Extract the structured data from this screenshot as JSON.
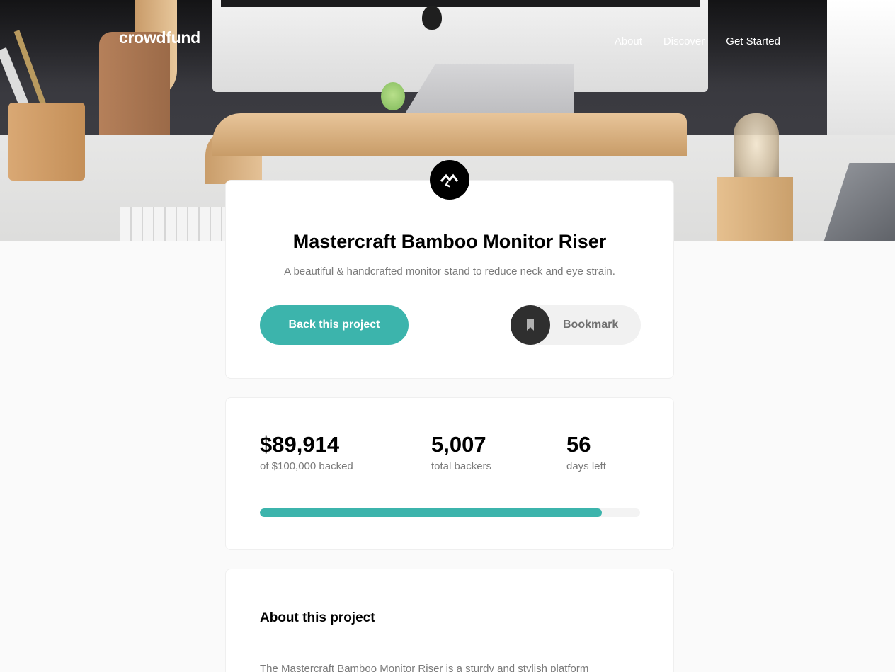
{
  "brand": {
    "logo": "crowdfund"
  },
  "nav": [
    {
      "label": "About"
    },
    {
      "label": "Discover"
    },
    {
      "label": "Get Started"
    }
  ],
  "project": {
    "title": "Mastercraft Bamboo Monitor Riser",
    "subtitle": "A beautiful & handcrafted monitor stand to reduce neck and eye strain.",
    "back_label": "Back this project",
    "bookmark_label": "Bookmark"
  },
  "stats": {
    "backed": {
      "value": "$89,914",
      "label": "of $100,000 backed"
    },
    "backers": {
      "value": "5,007",
      "label": "total backers"
    },
    "days": {
      "value": "56",
      "label": "days left"
    },
    "progress_fraction": 0.899
  },
  "about": {
    "title": "About this project",
    "text": "The Mastercraft Bamboo Monitor Riser is a sturdy and stylish platform"
  },
  "colors": {
    "accent": "#3cb4ac",
    "dark": "#2f2f2f",
    "muted_text": "#7a7a7a"
  },
  "icons": {
    "logo_mark": "mastercraft-logo-icon",
    "bookmark": "bookmark-icon"
  }
}
